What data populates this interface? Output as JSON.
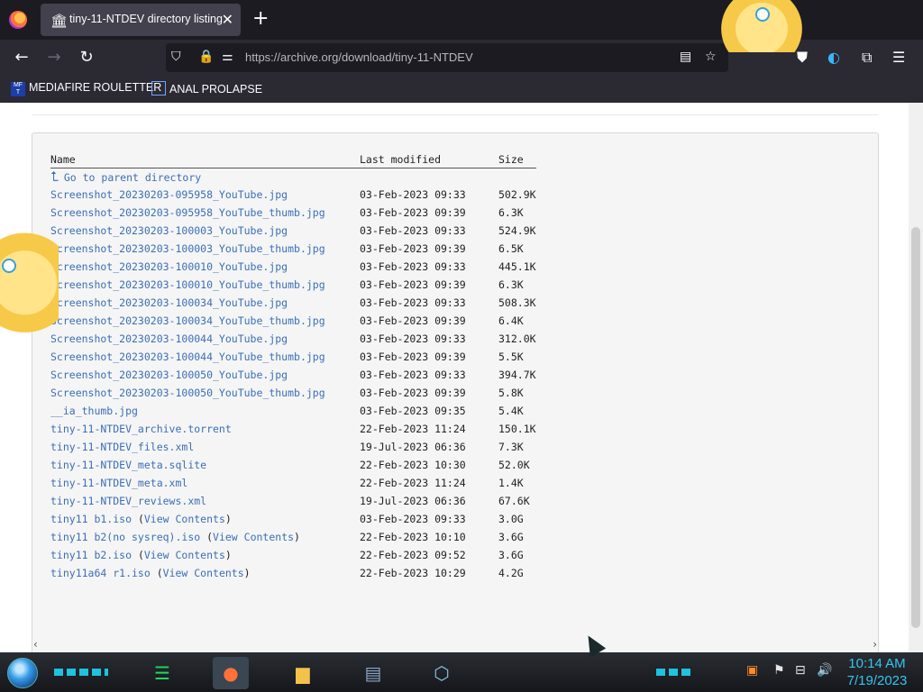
{
  "browser": {
    "tab_title": "tiny-11-NTDEV directory listing",
    "tab_icon": "archive-icon",
    "url": "https://archive.org/download/tiny-11-NTDEV",
    "bookmarks": [
      {
        "label": "MEDIAFIRE ROULETTER",
        "icon": "mediafire-icon"
      },
      {
        "label": "ANAL PROLAPSE",
        "icon": "bookmark-icon"
      }
    ]
  },
  "listing": {
    "headers": {
      "name": "Name",
      "modified": "Last modified",
      "size": "Size"
    },
    "parent_label": "Go to parent directory",
    "rows": [
      {
        "name": "Screenshot_20230203-095958_YouTube.jpg",
        "extra": "",
        "modified": "03-Feb-2023 09:33",
        "size": "502.9K"
      },
      {
        "name": "Screenshot_20230203-095958_YouTube_thumb.jpg",
        "extra": "",
        "modified": "03-Feb-2023 09:39",
        "size": "6.3K"
      },
      {
        "name": "Screenshot_20230203-100003_YouTube.jpg",
        "extra": "",
        "modified": "03-Feb-2023 09:33",
        "size": "524.9K"
      },
      {
        "name": "Screenshot_20230203-100003_YouTube_thumb.jpg",
        "extra": "",
        "modified": "03-Feb-2023 09:39",
        "size": "6.5K"
      },
      {
        "name": "Screenshot_20230203-100010_YouTube.jpg",
        "extra": "",
        "modified": "03-Feb-2023 09:33",
        "size": "445.1K"
      },
      {
        "name": "Screenshot_20230203-100010_YouTube_thumb.jpg",
        "extra": "",
        "modified": "03-Feb-2023 09:39",
        "size": "6.3K"
      },
      {
        "name": "Screenshot_20230203-100034_YouTube.jpg",
        "extra": "",
        "modified": "03-Feb-2023 09:33",
        "size": "508.3K"
      },
      {
        "name": "Screenshot_20230203-100034_YouTube_thumb.jpg",
        "extra": "",
        "modified": "03-Feb-2023 09:39",
        "size": "6.4K"
      },
      {
        "name": "Screenshot_20230203-100044_YouTube.jpg",
        "extra": "",
        "modified": "03-Feb-2023 09:33",
        "size": "312.0K"
      },
      {
        "name": "Screenshot_20230203-100044_YouTube_thumb.jpg",
        "extra": "",
        "modified": "03-Feb-2023 09:39",
        "size": "5.5K"
      },
      {
        "name": "Screenshot_20230203-100050_YouTube.jpg",
        "extra": "",
        "modified": "03-Feb-2023 09:33",
        "size": "394.7K"
      },
      {
        "name": "Screenshot_20230203-100050_YouTube_thumb.jpg",
        "extra": "",
        "modified": "03-Feb-2023 09:39",
        "size": "5.8K"
      },
      {
        "name": "__ia_thumb.jpg",
        "extra": "",
        "modified": "03-Feb-2023 09:35",
        "size": "5.4K"
      },
      {
        "name": "tiny-11-NTDEV_archive.torrent",
        "extra": "",
        "modified": "22-Feb-2023 11:24",
        "size": "150.1K"
      },
      {
        "name": "tiny-11-NTDEV_files.xml",
        "extra": "",
        "modified": "19-Jul-2023 06:36",
        "size": "7.3K"
      },
      {
        "name": "tiny-11-NTDEV_meta.sqlite",
        "extra": "",
        "modified": "22-Feb-2023 10:30",
        "size": "52.0K"
      },
      {
        "name": "tiny-11-NTDEV_meta.xml",
        "extra": "",
        "modified": "22-Feb-2023 11:24",
        "size": "1.4K"
      },
      {
        "name": "tiny-11-NTDEV_reviews.xml",
        "extra": "",
        "modified": "19-Jul-2023 06:36",
        "size": "67.6K"
      },
      {
        "name": "tiny11 b1.iso",
        "extra": "View Contents",
        "modified": "03-Feb-2023 09:33",
        "size": "3.0G"
      },
      {
        "name": "tiny11 b2(no sysreq).iso",
        "extra": "View Contents",
        "modified": "22-Feb-2023 10:10",
        "size": "3.6G"
      },
      {
        "name": "tiny11 b2.iso",
        "extra": "View Contents",
        "modified": "22-Feb-2023 09:52",
        "size": "3.6G"
      },
      {
        "name": "tiny11a64 r1.iso",
        "extra": "View Contents",
        "modified": "22-Feb-2023 10:29",
        "size": "4.2G"
      }
    ]
  },
  "taskbar": {
    "apps": [
      "spotify-icon",
      "firefox-icon",
      "file-explorer-icon",
      "control-panel-icon",
      "virtualbox-icon"
    ],
    "clock_time": "10:14 AM",
    "clock_date": "7/19/2023"
  }
}
